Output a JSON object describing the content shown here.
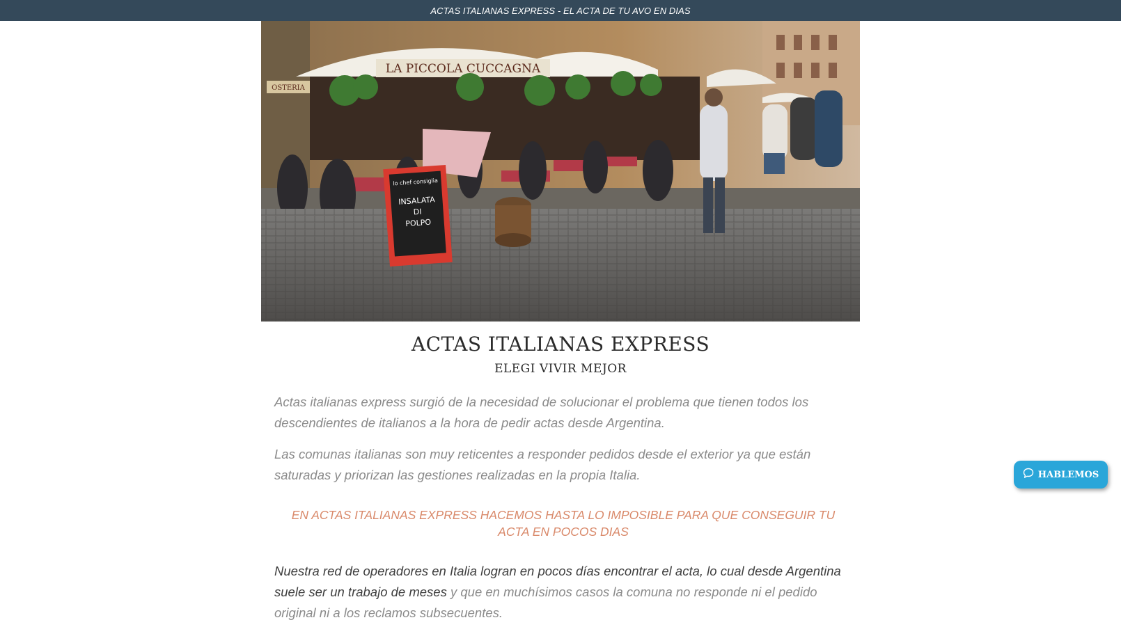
{
  "topbar": {
    "text": "ACTAS ITALIANAS EXPRESS - EL ACTA DE TU AVO EN DIAS"
  },
  "hero": {
    "sign_restaurant": "LA PICCOLA CUCCAGNA",
    "sign_osteria": "OSTERIA",
    "chalkboard_lines": [
      "lo chef consiglia",
      "INSALATA",
      "DI",
      "POLPO"
    ]
  },
  "main": {
    "title": "ACTAS ITALIANAS EXPRESS",
    "subtitle": "ELEGI VIVIR MEJOR",
    "paragraph1": "Actas italianas express surgió de la necesidad de solucionar el problema que tienen todos los descendientes de italianos a la hora de pedir actas desde Argentina.",
    "paragraph2": "Las comunas italianas son muy reticentes a responder pedidos desde el exterior ya que están saturadas y priorizan las gestiones realizadas en la propia Italia.",
    "highlight": "EN ACTAS ITALIANAS EXPRESS HACEMOS HASTA LO IMPOSIBLE PARA QUE CONSEGUIR TU ACTA EN POCOS DIAS",
    "paragraph3_strong": "Nuestra red de operadores en Italia logran en pocos días encontrar el acta, lo cual desde Argentina suele ser un trabajo de meses",
    "paragraph3_rest": " y que en muchísimos casos la comuna no responde ni el pedido original ni a los reclamos subsecuentes."
  },
  "chat": {
    "label": "HABLEMOS",
    "icon": "chat-bubble-icon"
  },
  "colors": {
    "topbar_bg": "#34495a",
    "highlight": "#d9896a",
    "chat_bg": "#2aa6d9"
  }
}
